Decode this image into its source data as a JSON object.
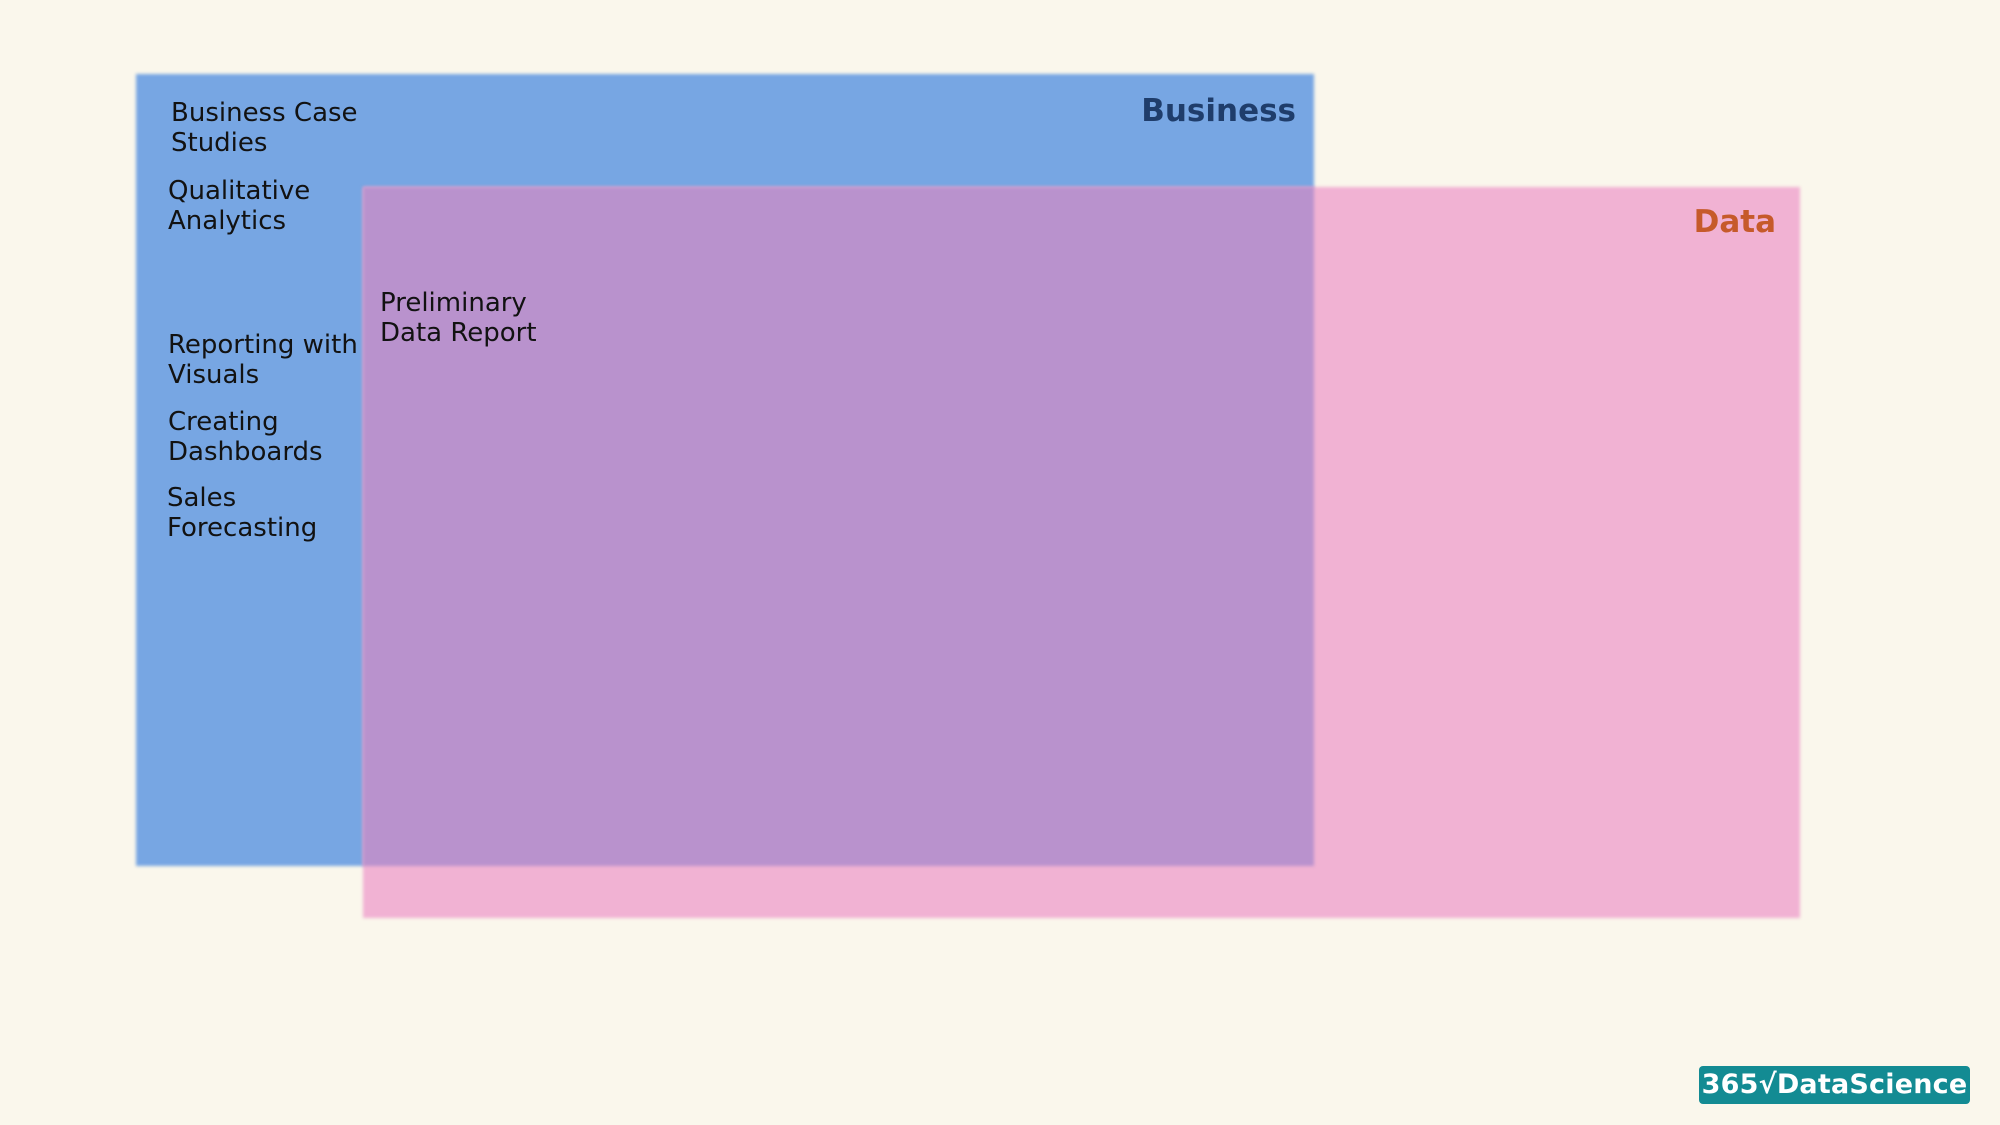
{
  "diagram": {
    "business": {
      "title": "Business",
      "color": "#77A6E3",
      "title_color": "#1F3D6B",
      "items": [
        "Business Case\nStudies",
        "Qualitative\nAnalytics",
        "Reporting with\nVisuals",
        "Creating\nDashboards",
        "Sales\nForecasting"
      ]
    },
    "data": {
      "title": "Data",
      "color": "#F1B2D3",
      "title_color": "#C65A2A",
      "items": []
    },
    "overlap": {
      "color": "#B992CD",
      "items": [
        "Preliminary\nData Report"
      ]
    }
  },
  "logo": {
    "text": "365√DataScience",
    "color": "#138B93"
  }
}
